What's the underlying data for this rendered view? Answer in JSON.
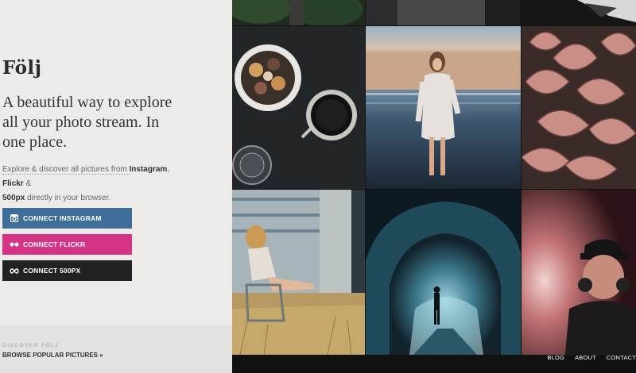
{
  "brand": {
    "name": "Följ"
  },
  "hero": {
    "tagline": "A beautiful way to explore all your photo stream. In one place.",
    "desc_prefix": "Explore & discover all pictures from ",
    "instagram": "Instagram",
    "comma": ", ",
    "flickr": "Flickr",
    "amp": " & ",
    "px500": "500px",
    "desc_suffix": " directly in your browser."
  },
  "buttons": {
    "instagram": {
      "label": "CONNECT INSTAGRAM",
      "color": "#3d6e99",
      "icon": "instagram-icon"
    },
    "flickr": {
      "label": "CONNECT FLICKR",
      "color": "#d43386",
      "icon": "flickr-icon"
    },
    "px500": {
      "label": "CONNECT 500PX",
      "color": "#222222",
      "icon": "infinity-icon"
    }
  },
  "discover": {
    "label": "DISCOVER FÖLJ",
    "link": "BROWSE POPULAR PICTURES »"
  },
  "footer_nav": [
    "BLOG",
    "ABOUT",
    "CONTACT"
  ],
  "photos": [
    "photo-top-strip-left",
    "photo-top-strip-middle",
    "photo-top-strip-right",
    "photo-food-and-coffee",
    "photo-woman-on-beach",
    "photo-protea-flowers",
    "photo-woman-by-trailer",
    "photo-ice-cave",
    "photo-man-with-headphones"
  ]
}
